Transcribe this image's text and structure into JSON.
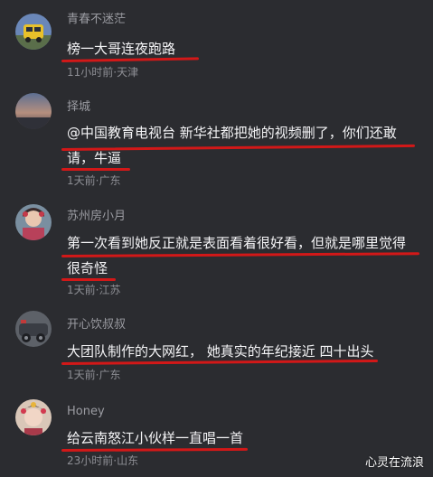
{
  "comments": [
    {
      "username": "青春不迷茫",
      "lines": [
        "榜一大哥连夜跑路"
      ],
      "meta": "11小时前·天津"
    },
    {
      "username": "择城",
      "lines": [
        "@中国教育电视台  新华社都把她的视频删了，你们还敢",
        "请，牛逼"
      ],
      "meta": "1天前·广东"
    },
    {
      "username": "苏州房小月",
      "lines": [
        "第一次看到她反正就是表面看着很好看，但就是哪里觉得",
        "很奇怪"
      ],
      "meta": "1天前·江苏"
    },
    {
      "username": "开心饮叔叔",
      "lines": [
        "大团队制作的大网红， 她真实的年纪接近 四十出头"
      ],
      "meta": "1天前·广东"
    },
    {
      "username": "Honey",
      "lines": [
        "给云南怒江小伙样一直唱一首"
      ],
      "meta": "23小时前·山东"
    }
  ],
  "watermark": "心灵在流浪",
  "colors": {
    "background": "#2b2c30",
    "comment_text": "#f4f4f6",
    "username": "#9b9ca2",
    "meta": "#8d8e94",
    "underline_annotation": "#d21818"
  }
}
